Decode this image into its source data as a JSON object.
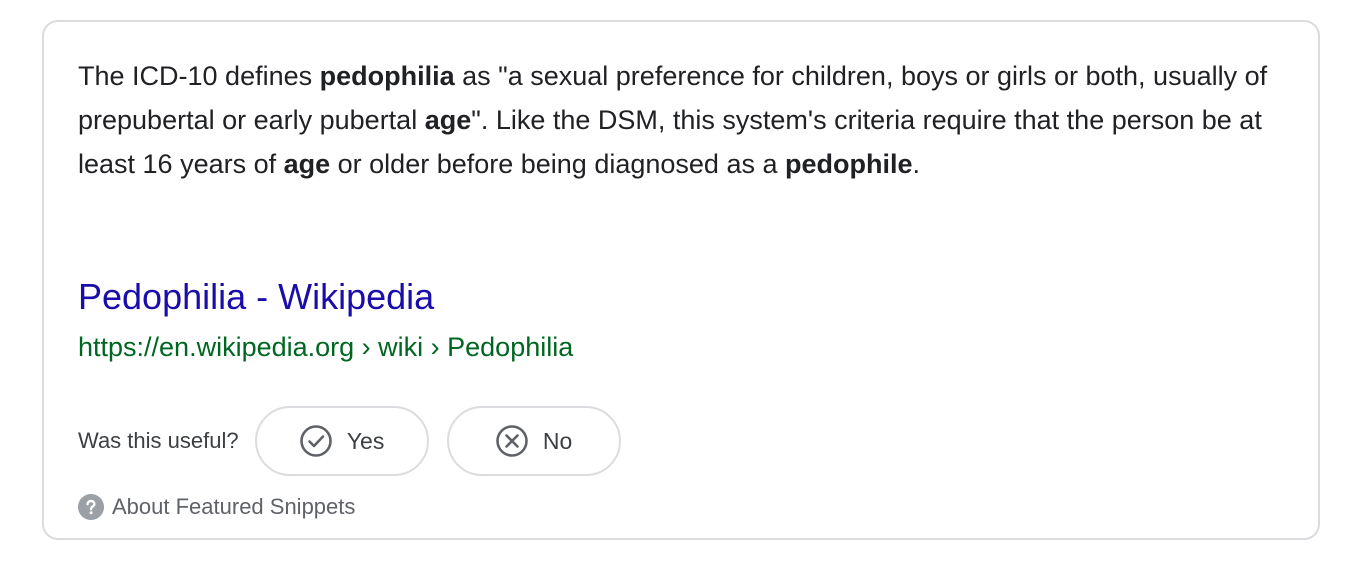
{
  "snippet": {
    "t1": "The ICD-10 defines ",
    "b1": "pedophilia",
    "t2": " as \"a sexual preference for children, boys or girls or both, usually of prepubertal or early pubertal ",
    "b2": "age",
    "t3": "\". Like the DSM, this system's criteria require that the person be at least 16 years of ",
    "b3": "age",
    "t4": " or older before being diagnosed as a ",
    "b4": "pedophile",
    "t5": "."
  },
  "result": {
    "title": "Pedophilia - Wikipedia",
    "url": "https://en.wikipedia.org › wiki › Pedophilia"
  },
  "feedback": {
    "question": "Was this useful?",
    "yes_label": "Yes",
    "no_label": "No",
    "yes_icon": "check-circle-icon",
    "no_icon": "x-circle-icon"
  },
  "about": {
    "label": "About Featured Snippets",
    "icon": "help-circle-icon"
  },
  "colors": {
    "link": "#1a0dab",
    "url": "#006621",
    "text": "#202124",
    "muted": "#5f6368",
    "border": "#dadce0"
  }
}
